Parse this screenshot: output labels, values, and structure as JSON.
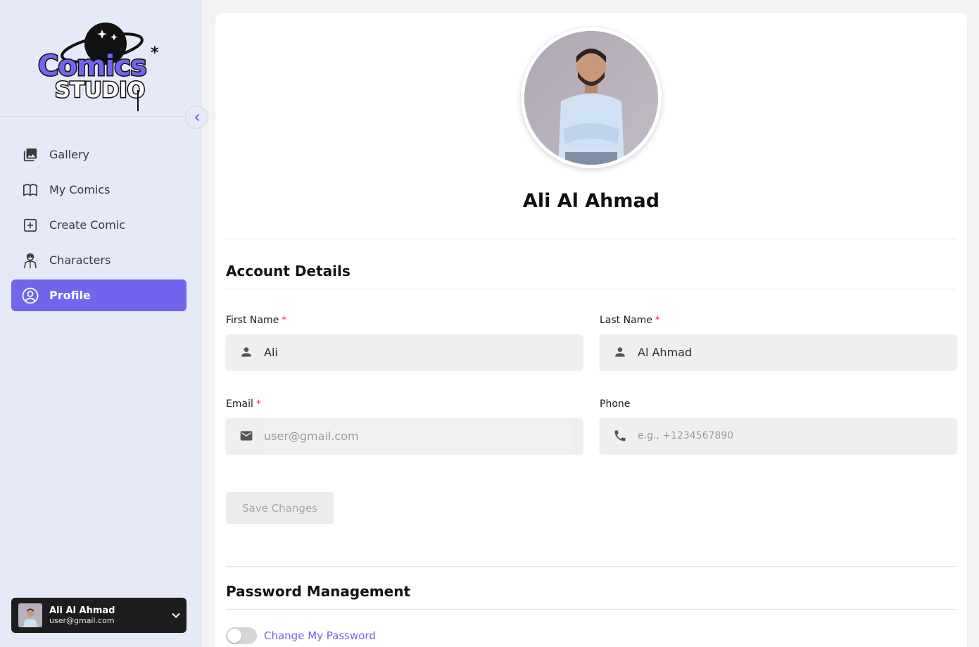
{
  "app": {
    "logo_text_top": "Comics",
    "logo_text_bottom": "STUDIO"
  },
  "sidebar": {
    "items": [
      {
        "label": "Gallery",
        "icon": "gallery-icon",
        "active": false
      },
      {
        "label": "My Comics",
        "icon": "book-icon",
        "active": false
      },
      {
        "label": "Create Comic",
        "icon": "add-box-icon",
        "active": false
      },
      {
        "label": "Characters",
        "icon": "character-icon",
        "active": false
      },
      {
        "label": "Profile",
        "icon": "account-circle-icon",
        "active": true
      }
    ],
    "user": {
      "name": "Ali Al Ahmad",
      "email": "user@gmail.com"
    }
  },
  "profile": {
    "name": "Ali Al Ahmad"
  },
  "account_details": {
    "title": "Account Details",
    "first_name": {
      "label": "First Name",
      "required": "*",
      "value": "Ali"
    },
    "last_name": {
      "label": "Last Name",
      "required": "*",
      "value": "Al Ahmad"
    },
    "email": {
      "label": "Email",
      "required": "*",
      "value": "user@gmail.com"
    },
    "phone": {
      "label": "Phone",
      "placeholder": "e.g., +1234567890",
      "value": ""
    },
    "save_label": "Save Changes"
  },
  "password_management": {
    "title": "Password Management",
    "toggle_label": "Change My Password"
  },
  "colors": {
    "accent": "#7165ee",
    "sidebar_bg": "#e6e9f7",
    "required": "#e23b3b"
  }
}
